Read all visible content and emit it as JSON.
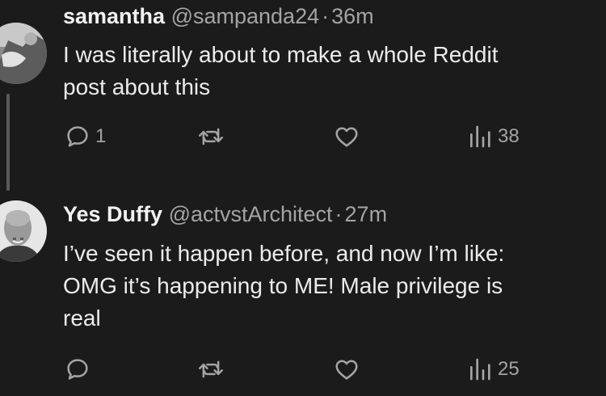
{
  "posts": [
    {
      "display_name": "samantha",
      "handle": "@sampanda24",
      "separator": "·",
      "time": "36m",
      "text_lines": [
        "I was literally about to make a whole Reddit",
        "post about this"
      ],
      "actions": {
        "reply_count": "1",
        "repost_count": "",
        "like_count": "",
        "views_count": "38"
      }
    },
    {
      "display_name": "Yes Duffy",
      "handle": "@actvstArchitect",
      "separator": "·",
      "time": "27m",
      "text_lines": [
        "I’ve seen it happen before, and now I’m like:",
        "OMG it’s happening to ME! Male privilege is",
        "real"
      ],
      "actions": {
        "reply_count": "",
        "repost_count": "",
        "like_count": "",
        "views_count": "25"
      }
    }
  ],
  "icons": {
    "reply": "speech-bubble-icon",
    "repost": "repost-arrows-icon",
    "like": "heart-icon",
    "views": "bar-chart-icon"
  },
  "colors": {
    "background": "#1b1b1b",
    "primary_text": "#ececec",
    "secondary_text": "#a4a4a4",
    "thread_line": "#5a5a5a"
  }
}
